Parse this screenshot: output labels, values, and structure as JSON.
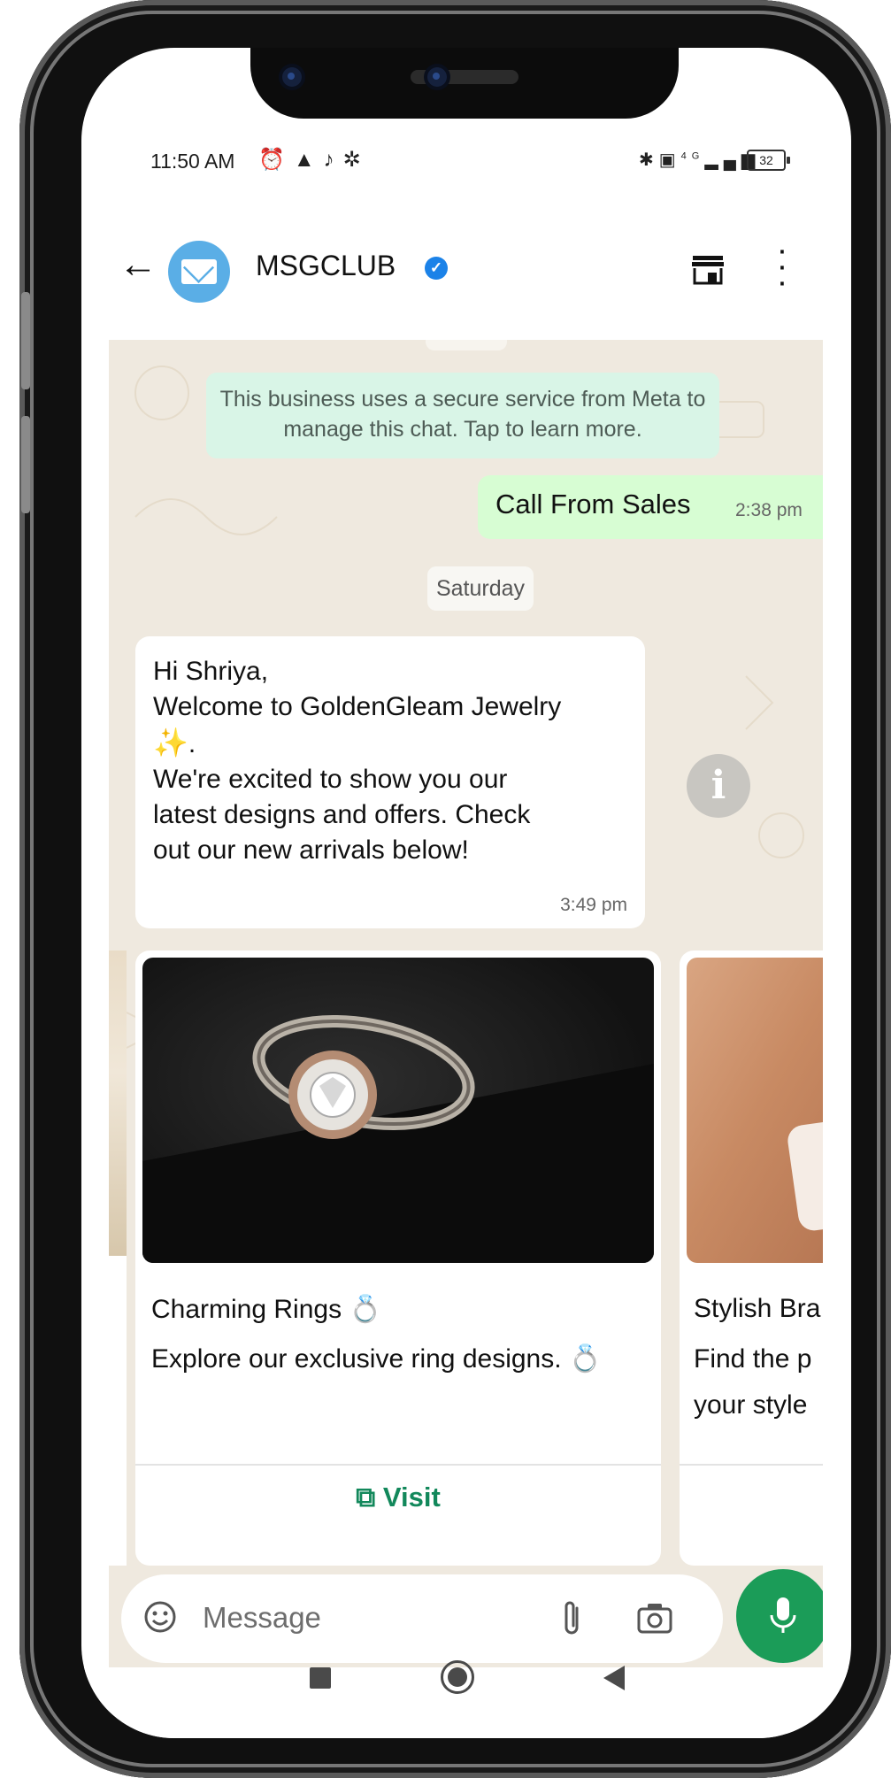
{
  "status_bar": {
    "time": "11:50 AM",
    "left_icons": [
      "alarm-icon",
      "warning-icon",
      "tiktok-icon",
      "gear-icon"
    ],
    "right_icons": [
      "bluetooth-icon",
      "volte-icon",
      "4g-signal-icon"
    ],
    "network_label": "4G",
    "battery_level": "32"
  },
  "header": {
    "contact_name": "MSGCLUB",
    "verified_badge": "✓"
  },
  "chat": {
    "system_note": "This business uses a secure service from Meta to manage this chat. Tap to learn more.",
    "outgoing": {
      "text": "Call From Sales",
      "time": "2:38 pm",
      "ticks": "✓✓"
    },
    "day_label": "Saturday",
    "incoming": {
      "line1": "Hi Shriya,",
      "line2": "Welcome to GoldenGleam Jewelry",
      "line3_emoji": "✨",
      "line3_rest": ".",
      "line4": "We're excited to show you our",
      "line5": "latest designs and offers. Check",
      "line6": "out our new arrivals below!",
      "time": "3:49 pm"
    },
    "info_icon_label": "i"
  },
  "carousel": {
    "cards": [
      {
        "title": "Charming Rings 💍",
        "description": "Explore our exclusive ring designs. 💍",
        "button_label": "Visit",
        "button_icon": "external-link-icon"
      },
      {
        "title": "Stylish Bra",
        "description": "Find the p\nyour style"
      }
    ]
  },
  "composer": {
    "placeholder": "Message"
  },
  "colors": {
    "chat_background": "#efe9df",
    "outgoing_bubble": "#d7fdd3",
    "system_note": "#d9f5e7",
    "accent_green": "#1b9c58",
    "visit_link": "#12885b",
    "verified_blue": "#1b82e8",
    "avatar_blue": "#5aaee6"
  }
}
